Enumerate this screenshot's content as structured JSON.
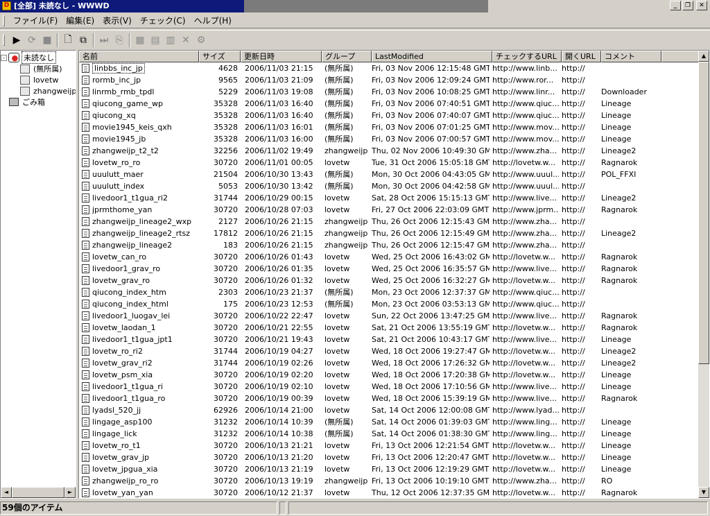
{
  "window": {
    "title": "[全部] 未読なし - WWWD",
    "app_icon_label": "D",
    "minimize": "_",
    "maximize": "❐",
    "close": "✕"
  },
  "menu": [
    "ファイル(F)",
    "編集(E)",
    "表示(V)",
    "チェック(C)",
    "ヘルプ(H)"
  ],
  "toolbar": {
    "buttons": [
      {
        "name": "start-check-icon",
        "glyph": "▶",
        "disabled": false
      },
      {
        "name": "check-item-icon",
        "glyph": "⟳",
        "disabled": true
      },
      {
        "name": "stop-icon",
        "glyph": "■",
        "disabled": true
      },
      {
        "name": "new-item-icon",
        "glyph": "🗋",
        "disabled": false
      },
      {
        "name": "new-folder-icon",
        "glyph": "⧉",
        "disabled": false
      },
      {
        "name": "jump-icon",
        "glyph": "⏭",
        "disabled": true
      },
      {
        "name": "copy-icon",
        "glyph": "⎘",
        "disabled": true
      },
      {
        "name": "edit-icon",
        "glyph": "▦",
        "disabled": true
      },
      {
        "name": "properties-icon",
        "glyph": "▤",
        "disabled": true
      },
      {
        "name": "paste-icon",
        "glyph": "▥",
        "disabled": true
      },
      {
        "name": "delete-icon",
        "glyph": "✕",
        "disabled": true
      },
      {
        "name": "settings-icon",
        "glyph": "⚙",
        "disabled": true
      }
    ]
  },
  "tree": {
    "root": "未読なし",
    "groups": [
      "(無所属)",
      "lovetw",
      "zhangweijp"
    ],
    "trash": "ごみ箱",
    "expander": "-"
  },
  "columns": {
    "name": "名前",
    "size": "サイズ",
    "date": "更新日時",
    "group": "グループ",
    "lastmodified": "LastModified",
    "check_url": "チェックするURL",
    "open_url": "開くURL",
    "comment": "コメント"
  },
  "rows": [
    {
      "name": "linbbs_inc_jp",
      "size": "4628",
      "date": "2006/11/03 21:15",
      "group": "(無所属)",
      "lm": "Fri, 03 Nov 2006 12:15:48 GMT",
      "url": "http://www.linb...",
      "open": "http://",
      "comment": ""
    },
    {
      "name": "rormb_inc_jp",
      "size": "9565",
      "date": "2006/11/03 21:09",
      "group": "(無所属)",
      "lm": "Fri, 03 Nov 2006 12:09:24 GMT",
      "url": "http://www.ror...",
      "open": "http://",
      "comment": ""
    },
    {
      "name": "linrmb_rmb_tpdl",
      "size": "5229",
      "date": "2006/11/03 19:08",
      "group": "(無所属)",
      "lm": "Fri, 03 Nov 2006 10:08:25 GMT",
      "url": "http://www.linr...",
      "open": "http://",
      "comment": "Downloader"
    },
    {
      "name": "qiucong_game_wp",
      "size": "35328",
      "date": "2006/11/03 16:40",
      "group": "(無所属)",
      "lm": "Fri, 03 Nov 2006 07:40:51 GMT",
      "url": "http://www.qiuc...",
      "open": "http://",
      "comment": "Lineage"
    },
    {
      "name": "qiucong_xq",
      "size": "35328",
      "date": "2006/11/03 16:40",
      "group": "(無所属)",
      "lm": "Fri, 03 Nov 2006 07:40:07 GMT",
      "url": "http://www.qiuc...",
      "open": "http://",
      "comment": "Lineage"
    },
    {
      "name": "movie1945_keis_qxh",
      "size": "35328",
      "date": "2006/11/03 16:01",
      "group": "(無所属)",
      "lm": "Fri, 03 Nov 2006 07:01:25 GMT",
      "url": "http://www.mov...",
      "open": "http://",
      "comment": "Lineage"
    },
    {
      "name": "movie1945_jb",
      "size": "35328",
      "date": "2006/11/03 16:00",
      "group": "(無所属)",
      "lm": "Fri, 03 Nov 2006 07:00:57 GMT",
      "url": "http://www.mov...",
      "open": "http://",
      "comment": "Lineage"
    },
    {
      "name": "zhangweijp_t2_t2",
      "size": "32256",
      "date": "2006/11/02 19:49",
      "group": "zhangweijp",
      "lm": "Thu, 02 Nov 2006 10:49:30 GMT",
      "url": "http://www.zha...",
      "open": "http://",
      "comment": "Lineage2"
    },
    {
      "name": "lovetw_ro_ro",
      "size": "30720",
      "date": "2006/11/01 00:05",
      "group": "lovetw",
      "lm": "Tue, 31 Oct 2006 15:05:18 GMT",
      "url": "http://lovetw.w...",
      "open": "http://",
      "comment": "Ragnarok"
    },
    {
      "name": "uuulutt_maer",
      "size": "21504",
      "date": "2006/10/30 13:43",
      "group": "(無所属)",
      "lm": "Mon, 30 Oct 2006 04:43:05 GMT",
      "url": "http://www.uuul...",
      "open": "http://",
      "comment": "POL_FFXI"
    },
    {
      "name": "uuulutt_index",
      "size": "5053",
      "date": "2006/10/30 13:42",
      "group": "(無所属)",
      "lm": "Mon, 30 Oct 2006 04:42:58 GMT",
      "url": "http://www.uuul...",
      "open": "http://",
      "comment": ""
    },
    {
      "name": "livedoor1_t1gua_ri2",
      "size": "31744",
      "date": "2006/10/29 00:15",
      "group": "lovetw",
      "lm": "Sat, 28 Oct 2006 15:15:13 GMT",
      "url": "http://www.live...",
      "open": "http://",
      "comment": "Lineage2"
    },
    {
      "name": "jprmthome_yan",
      "size": "30720",
      "date": "2006/10/28 07:03",
      "group": "lovetw",
      "lm": "Fri, 27 Oct 2006 22:03:09 GMT",
      "url": "http://www.jprm...",
      "open": "http://",
      "comment": "Ragnarok"
    },
    {
      "name": "zhangweijp_lineage2_wxp",
      "size": "2127",
      "date": "2006/10/26 21:15",
      "group": "zhangweijp",
      "lm": "Thu, 26 Oct 2006 12:15:43 GMT",
      "url": "http://www.zha...",
      "open": "http://",
      "comment": ""
    },
    {
      "name": "zhangweijp_lineage2_rtsz",
      "size": "17812",
      "date": "2006/10/26 21:15",
      "group": "zhangweijp",
      "lm": "Thu, 26 Oct 2006 12:15:49 GMT",
      "url": "http://www.zha...",
      "open": "http://",
      "comment": "Lineage2"
    },
    {
      "name": "zhangweijp_lineage2",
      "size": "183",
      "date": "2006/10/26 21:15",
      "group": "zhangweijp",
      "lm": "Thu, 26 Oct 2006 12:15:47 GMT",
      "url": "http://www.zha...",
      "open": "http://",
      "comment": ""
    },
    {
      "name": "lovetw_can_ro",
      "size": "30720",
      "date": "2006/10/26 01:43",
      "group": "lovetw",
      "lm": "Wed, 25 Oct 2006 16:43:02 GMT",
      "url": "http://lovetw.w...",
      "open": "http://",
      "comment": "Ragnarok"
    },
    {
      "name": "livedoor1_grav_ro",
      "size": "30720",
      "date": "2006/10/26 01:35",
      "group": "lovetw",
      "lm": "Wed, 25 Oct 2006 16:35:57 GMT",
      "url": "http://www.live...",
      "open": "http://",
      "comment": "Ragnarok"
    },
    {
      "name": "lovetw_grav_ro",
      "size": "30720",
      "date": "2006/10/26 01:32",
      "group": "lovetw",
      "lm": "Wed, 25 Oct 2006 16:32:27 GMT",
      "url": "http://lovetw.w...",
      "open": "http://",
      "comment": "Ragnarok"
    },
    {
      "name": "qiucong_index_htm",
      "size": "2303",
      "date": "2006/10/23 21:37",
      "group": "(無所属)",
      "lm": "Mon, 23 Oct 2006 12:37:37 GMT",
      "url": "http://www.qiuc...",
      "open": "http://",
      "comment": ""
    },
    {
      "name": "qiucong_index_html",
      "size": "175",
      "date": "2006/10/23 12:53",
      "group": "(無所属)",
      "lm": "Mon, 23 Oct 2006 03:53:13 GMT",
      "url": "http://www.qiuc...",
      "open": "http://",
      "comment": ""
    },
    {
      "name": "livedoor1_luogav_lei",
      "size": "30720",
      "date": "2006/10/22 22:47",
      "group": "lovetw",
      "lm": "Sun, 22 Oct 2006 13:47:25 GMT",
      "url": "http://www.live...",
      "open": "http://",
      "comment": "Ragnarok"
    },
    {
      "name": "lovetw_laodan_1",
      "size": "30720",
      "date": "2006/10/21 22:55",
      "group": "lovetw",
      "lm": "Sat, 21 Oct 2006 13:55:19 GMT",
      "url": "http://lovetw.w...",
      "open": "http://",
      "comment": "Ragnarok"
    },
    {
      "name": "livedoor1_t1gua_jpt1",
      "size": "30720",
      "date": "2006/10/21 19:43",
      "group": "lovetw",
      "lm": "Sat, 21 Oct 2006 10:43:17 GMT",
      "url": "http://www.live...",
      "open": "http://",
      "comment": "Lineage"
    },
    {
      "name": "lovetw_ro_ri2",
      "size": "31744",
      "date": "2006/10/19 04:27",
      "group": "lovetw",
      "lm": "Wed, 18 Oct 2006 19:27:47 GMT",
      "url": "http://lovetw.w...",
      "open": "http://",
      "comment": "Lineage2"
    },
    {
      "name": "lovetw_grav_ri2",
      "size": "31744",
      "date": "2006/10/19 02:26",
      "group": "lovetw",
      "lm": "Wed, 18 Oct 2006 17:26:32 GMT",
      "url": "http://lovetw.w...",
      "open": "http://",
      "comment": "Lineage2"
    },
    {
      "name": "lovetw_psm_xia",
      "size": "30720",
      "date": "2006/10/19 02:20",
      "group": "lovetw",
      "lm": "Wed, 18 Oct 2006 17:20:38 GMT",
      "url": "http://lovetw.w...",
      "open": "http://",
      "comment": "Lineage"
    },
    {
      "name": "livedoor1_t1gua_ri",
      "size": "30720",
      "date": "2006/10/19 02:10",
      "group": "lovetw",
      "lm": "Wed, 18 Oct 2006 17:10:56 GMT",
      "url": "http://www.live...",
      "open": "http://",
      "comment": "Lineage"
    },
    {
      "name": "livedoor1_t1gua_ro",
      "size": "30720",
      "date": "2006/10/19 00:39",
      "group": "lovetw",
      "lm": "Wed, 18 Oct 2006 15:39:19 GMT",
      "url": "http://www.live...",
      "open": "http://",
      "comment": "Ragnarok"
    },
    {
      "name": "lyadsl_520_jj",
      "size": "62926",
      "date": "2006/10/14 21:00",
      "group": "lovetw",
      "lm": "Sat, 14 Oct 2006 12:00:08 GMT",
      "url": "http://www.lyad...",
      "open": "http://",
      "comment": ""
    },
    {
      "name": "lingage_asp100",
      "size": "31232",
      "date": "2006/10/14 10:39",
      "group": "(無所属)",
      "lm": "Sat, 14 Oct 2006 01:39:03 GMT",
      "url": "http://www.ling...",
      "open": "http://",
      "comment": "Lineage"
    },
    {
      "name": "lingage_lick",
      "size": "31232",
      "date": "2006/10/14 10:38",
      "group": "(無所属)",
      "lm": "Sat, 14 Oct 2006 01:38:30 GMT",
      "url": "http://www.ling...",
      "open": "http://",
      "comment": "Lineage"
    },
    {
      "name": "lovetw_ro_t1",
      "size": "30720",
      "date": "2006/10/13 21:21",
      "group": "lovetw",
      "lm": "Fri, 13 Oct 2006 12:21:54 GMT",
      "url": "http://lovetw.w...",
      "open": "http://",
      "comment": "Lineage"
    },
    {
      "name": "lovetw_grav_jp",
      "size": "30720",
      "date": "2006/10/13 21:20",
      "group": "lovetw",
      "lm": "Fri, 13 Oct 2006 12:20:47 GMT",
      "url": "http://lovetw.w...",
      "open": "http://",
      "comment": "Lineage"
    },
    {
      "name": "lovetw_jpgua_xia",
      "size": "30720",
      "date": "2006/10/13 21:19",
      "group": "lovetw",
      "lm": "Fri, 13 Oct 2006 12:19:29 GMT",
      "url": "http://lovetw.w...",
      "open": "http://",
      "comment": "Lineage"
    },
    {
      "name": "zhangweijp_ro_ro",
      "size": "30720",
      "date": "2006/10/13 19:19",
      "group": "zhangweijp",
      "lm": "Fri, 13 Oct 2006 10:19:10 GMT",
      "url": "http://www.zha...",
      "open": "http://",
      "comment": "RO"
    },
    {
      "name": "lovetw_yan_yan",
      "size": "30720",
      "date": "2006/10/12 21:37",
      "group": "lovetw",
      "lm": "Thu, 12 Oct 2006 12:37:35 GMT",
      "url": "http://lovetw.w...",
      "open": "http://",
      "comment": "Ragnarok"
    }
  ],
  "status": {
    "count_text": "59個のアイテム"
  },
  "scroll": {
    "left": "◄",
    "right": "►",
    "up": "▲",
    "down": "▼"
  }
}
